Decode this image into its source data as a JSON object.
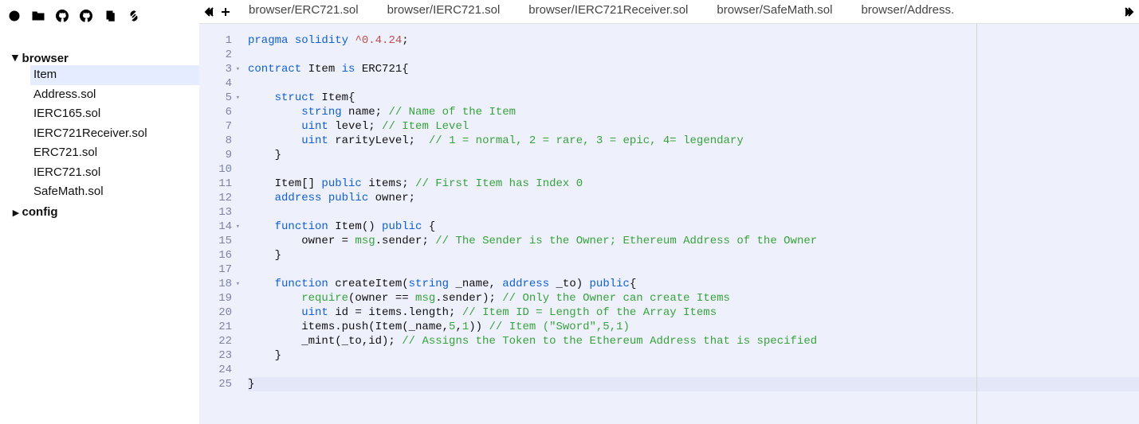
{
  "sidebar": {
    "folders": [
      {
        "name": "browser",
        "expanded": true,
        "files": [
          {
            "name": "Item",
            "selected": true
          },
          {
            "name": "Address.sol",
            "selected": false
          },
          {
            "name": "IERC165.sol",
            "selected": false
          },
          {
            "name": "IERC721Receiver.sol",
            "selected": false
          },
          {
            "name": "ERC721.sol",
            "selected": false
          },
          {
            "name": "IERC721.sol",
            "selected": false
          },
          {
            "name": "SafeMath.sol",
            "selected": false
          }
        ]
      },
      {
        "name": "config",
        "expanded": false,
        "files": []
      }
    ]
  },
  "tabs": [
    {
      "label": "browser/ERC721.sol",
      "active": false
    },
    {
      "label": "browser/IERC721.sol",
      "active": false
    },
    {
      "label": "browser/IERC721Receiver.sol",
      "active": false
    },
    {
      "label": "browser/SafeMath.sol",
      "active": false
    },
    {
      "label": "browser/Address.",
      "active": false
    }
  ],
  "editor": {
    "first_line": 1,
    "highlighted_line": 25,
    "lines": [
      {
        "n": 1,
        "fold": false,
        "tokens": [
          [
            "kw",
            "pragma"
          ],
          [
            "",
            " "
          ],
          [
            "kw",
            "solidity"
          ],
          [
            "",
            " "
          ],
          [
            "str",
            "^0.4.24"
          ],
          [
            "",
            ";"
          ]
        ]
      },
      {
        "n": 2,
        "fold": false,
        "tokens": []
      },
      {
        "n": 3,
        "fold": true,
        "tokens": [
          [
            "kw",
            "contract"
          ],
          [
            "",
            " Item "
          ],
          [
            "kw",
            "is"
          ],
          [
            "",
            " ERC721{"
          ]
        ]
      },
      {
        "n": 4,
        "fold": false,
        "tokens": []
      },
      {
        "n": 5,
        "fold": true,
        "tokens": [
          [
            "",
            "    "
          ],
          [
            "kw",
            "struct"
          ],
          [
            "",
            " Item{"
          ]
        ]
      },
      {
        "n": 6,
        "fold": false,
        "tokens": [
          [
            "",
            "        "
          ],
          [
            "kw",
            "string"
          ],
          [
            "",
            " name; "
          ],
          [
            "cmt",
            "// Name of the Item"
          ]
        ]
      },
      {
        "n": 7,
        "fold": false,
        "tokens": [
          [
            "",
            "        "
          ],
          [
            "kw",
            "uint"
          ],
          [
            "",
            " level; "
          ],
          [
            "cmt",
            "// Item Level"
          ]
        ]
      },
      {
        "n": 8,
        "fold": false,
        "tokens": [
          [
            "",
            "        "
          ],
          [
            "kw",
            "uint"
          ],
          [
            "",
            " rarityLevel;  "
          ],
          [
            "cmt",
            "// 1 = normal, 2 = rare, 3 = epic, 4= legendary"
          ]
        ]
      },
      {
        "n": 9,
        "fold": false,
        "tokens": [
          [
            "",
            "    }"
          ]
        ]
      },
      {
        "n": 10,
        "fold": false,
        "tokens": []
      },
      {
        "n": 11,
        "fold": false,
        "tokens": [
          [
            "",
            "    Item[] "
          ],
          [
            "kw",
            "public"
          ],
          [
            "",
            " items; "
          ],
          [
            "cmt",
            "// First Item has Index 0"
          ]
        ]
      },
      {
        "n": 12,
        "fold": false,
        "tokens": [
          [
            "",
            "    "
          ],
          [
            "kw",
            "address"
          ],
          [
            "",
            " "
          ],
          [
            "kw",
            "public"
          ],
          [
            "",
            " owner;"
          ]
        ]
      },
      {
        "n": 13,
        "fold": false,
        "tokens": []
      },
      {
        "n": 14,
        "fold": true,
        "tokens": [
          [
            "",
            "    "
          ],
          [
            "kw",
            "function"
          ],
          [
            "",
            " Item() "
          ],
          [
            "kw",
            "public"
          ],
          [
            "",
            " {"
          ]
        ]
      },
      {
        "n": 15,
        "fold": false,
        "tokens": [
          [
            "",
            "        owner = "
          ],
          [
            "typ",
            "msg"
          ],
          [
            "",
            ".sender; "
          ],
          [
            "cmt",
            "// The Sender is the Owner; Ethereum Address of the Owner"
          ]
        ]
      },
      {
        "n": 16,
        "fold": false,
        "tokens": [
          [
            "",
            "    }"
          ]
        ]
      },
      {
        "n": 17,
        "fold": false,
        "tokens": []
      },
      {
        "n": 18,
        "fold": true,
        "tokens": [
          [
            "",
            "    "
          ],
          [
            "kw",
            "function"
          ],
          [
            "",
            " createItem("
          ],
          [
            "kw",
            "string"
          ],
          [
            "",
            " _name, "
          ],
          [
            "kw",
            "address"
          ],
          [
            "",
            " _to) "
          ],
          [
            "kw",
            "public"
          ],
          [
            "",
            "{"
          ]
        ]
      },
      {
        "n": 19,
        "fold": false,
        "tokens": [
          [
            "",
            "        "
          ],
          [
            "typ",
            "require"
          ],
          [
            "",
            "(owner == "
          ],
          [
            "typ",
            "msg"
          ],
          [
            "",
            ".sender); "
          ],
          [
            "cmt",
            "// Only the Owner can create Items"
          ]
        ]
      },
      {
        "n": 20,
        "fold": false,
        "tokens": [
          [
            "",
            "        "
          ],
          [
            "kw",
            "uint"
          ],
          [
            "",
            " id = items.length; "
          ],
          [
            "cmt",
            "// Item ID = Length of the Array Items"
          ]
        ]
      },
      {
        "n": 21,
        "fold": false,
        "tokens": [
          [
            "",
            "        items.push(Item(_name,"
          ],
          [
            "num",
            "5"
          ],
          [
            "",
            ","
          ],
          [
            "num",
            "1"
          ],
          [
            "",
            ")) "
          ],
          [
            "cmt",
            "// Item (\"Sword\",5,1)"
          ]
        ]
      },
      {
        "n": 22,
        "fold": false,
        "tokens": [
          [
            "",
            "        _mint(_to,id); "
          ],
          [
            "cmt",
            "// Assigns the Token to the Ethereum Address that is specified"
          ]
        ]
      },
      {
        "n": 23,
        "fold": false,
        "tokens": [
          [
            "",
            "    }"
          ]
        ]
      },
      {
        "n": 24,
        "fold": false,
        "tokens": []
      },
      {
        "n": 25,
        "fold": false,
        "tokens": [
          [
            "",
            "}"
          ]
        ]
      }
    ]
  }
}
